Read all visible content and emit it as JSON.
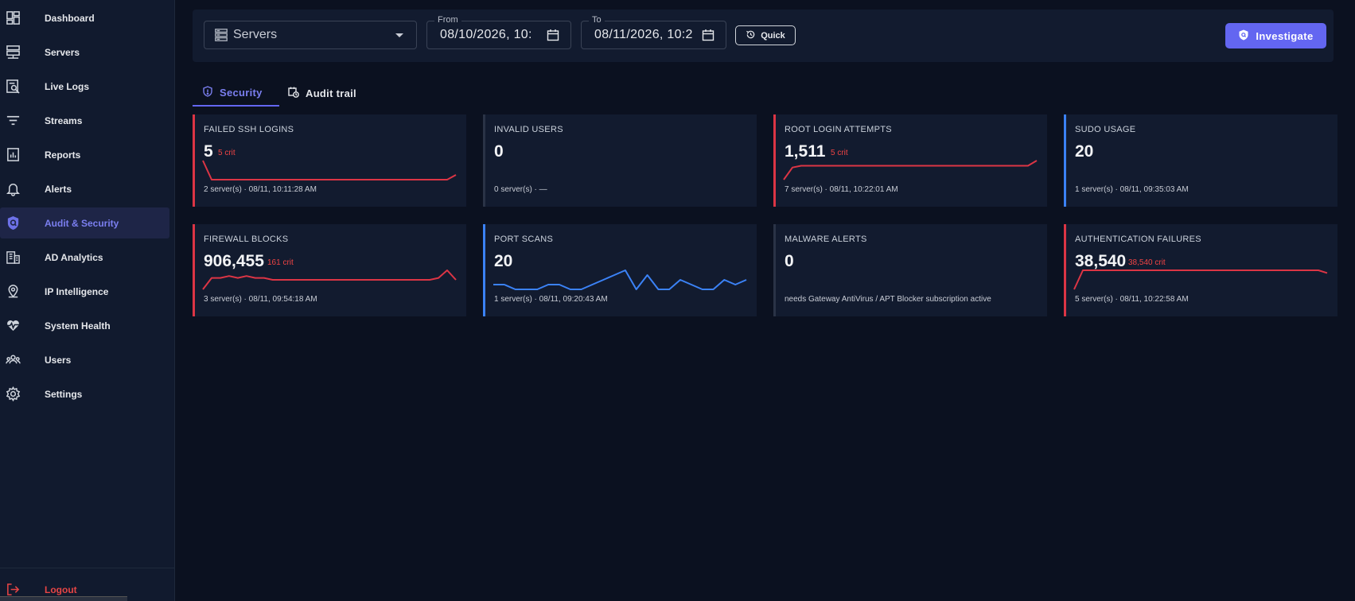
{
  "sidebar": {
    "items": [
      {
        "label": "Dashboard",
        "icon": "dashboard-icon"
      },
      {
        "label": "Servers",
        "icon": "servers-icon"
      },
      {
        "label": "Live Logs",
        "icon": "live-logs-icon"
      },
      {
        "label": "Streams",
        "icon": "streams-icon"
      },
      {
        "label": "Reports",
        "icon": "reports-icon"
      },
      {
        "label": "Alerts",
        "icon": "bell-icon"
      },
      {
        "label": "Audit & Security",
        "icon": "shield-icon"
      },
      {
        "label": "AD Analytics",
        "icon": "building-icon"
      },
      {
        "label": "IP Intelligence",
        "icon": "location-pin-icon"
      },
      {
        "label": "System Health",
        "icon": "heart-pulse-icon"
      },
      {
        "label": "Users",
        "icon": "users-icon"
      },
      {
        "label": "Settings",
        "icon": "gear-icon"
      }
    ],
    "active": "Audit & Security",
    "logout_label": "Logout"
  },
  "toolbar": {
    "server_select": {
      "value": "Servers",
      "icon": "server-icon"
    },
    "from": {
      "legend": "From",
      "value": "08/10/2026, 10:"
    },
    "to": {
      "legend": "To",
      "value": "08/11/2026, 10:2"
    },
    "quick_label": "Quick",
    "investigate_label": "Investigate"
  },
  "tabs": [
    {
      "label": "Security",
      "icon": "shield-icon",
      "active": true
    },
    {
      "label": "Audit trail",
      "icon": "calendar-clock-icon",
      "active": false
    }
  ],
  "colors": {
    "accent": "#6366f1",
    "critical": "#dc3545",
    "info": "#3b82f6"
  },
  "cards": [
    {
      "title": "FAILED SSH LOGINS",
      "value": "5",
      "crit": "5 crit",
      "footer": "2 server(s) · 08/11, 10:11:28 AM",
      "accent": "red",
      "trend": [
        9,
        1,
        1,
        1,
        1,
        1,
        1,
        1,
        1,
        1,
        1,
        1,
        1,
        1,
        1,
        1,
        1,
        1,
        1,
        1,
        1,
        1,
        1,
        1,
        1,
        1,
        1,
        1,
        1,
        3
      ]
    },
    {
      "title": "INVALID USERS",
      "value": "0",
      "crit": "",
      "footer": "0 server(s) · —",
      "accent": "gray",
      "trend": []
    },
    {
      "title": "ROOT LOGIN ATTEMPTS",
      "value": "1,511",
      "crit": "5 crit",
      "footer": "7 server(s) · 08/11, 10:22:01 AM",
      "accent": "red",
      "trend": [
        1,
        8,
        9,
        9,
        9,
        9,
        9,
        9,
        9,
        9,
        9,
        9,
        9,
        9,
        9,
        9,
        9,
        9,
        9,
        9,
        9,
        9,
        9,
        9,
        9,
        9,
        9,
        9,
        9,
        12
      ]
    },
    {
      "title": "SUDO USAGE",
      "value": "20",
      "crit": "",
      "footer": "1 server(s) · 08/11, 09:35:03 AM",
      "accent": "blue",
      "trend": []
    },
    {
      "title": "FIREWALL BLOCKS",
      "value": "906,455",
      "crit": "161 crit",
      "footer": "3 server(s) · 08/11, 09:54:18 AM",
      "accent": "red",
      "trend": [
        2,
        8,
        8,
        9,
        8,
        9,
        8,
        8,
        7,
        7,
        7,
        7,
        7,
        7,
        7,
        7,
        7,
        7,
        7,
        7,
        7,
        7,
        7,
        7,
        7,
        7,
        7,
        8,
        12,
        7
      ]
    },
    {
      "title": "PORT SCANS",
      "value": "20",
      "crit": "",
      "footer": "1 server(s) · 08/11, 09:20:43 AM",
      "accent": "blue",
      "trend": [
        6,
        6,
        5,
        5,
        5,
        6,
        6,
        5,
        5,
        6,
        7,
        8,
        9,
        5,
        8,
        5,
        5,
        7,
        6,
        5,
        5,
        7,
        6,
        7
      ]
    },
    {
      "title": "MALWARE ALERTS",
      "value": "0",
      "crit": "",
      "footer": "needs Gateway AntiVirus / APT Blocker subscription active",
      "accent": "gray",
      "trend": []
    },
    {
      "title": "AUTHENTICATION FAILURES",
      "value": "38,540",
      "crit": "38,540 crit",
      "footer": "5 server(s) · 08/11, 10:22:58 AM",
      "accent": "red",
      "trend": [
        1,
        8,
        8,
        8,
        8,
        8,
        8,
        8,
        8,
        8,
        8,
        8,
        8,
        8,
        8,
        8,
        8,
        8,
        8,
        8,
        8,
        8,
        8,
        8,
        8,
        8,
        8,
        8,
        8,
        7
      ]
    }
  ]
}
